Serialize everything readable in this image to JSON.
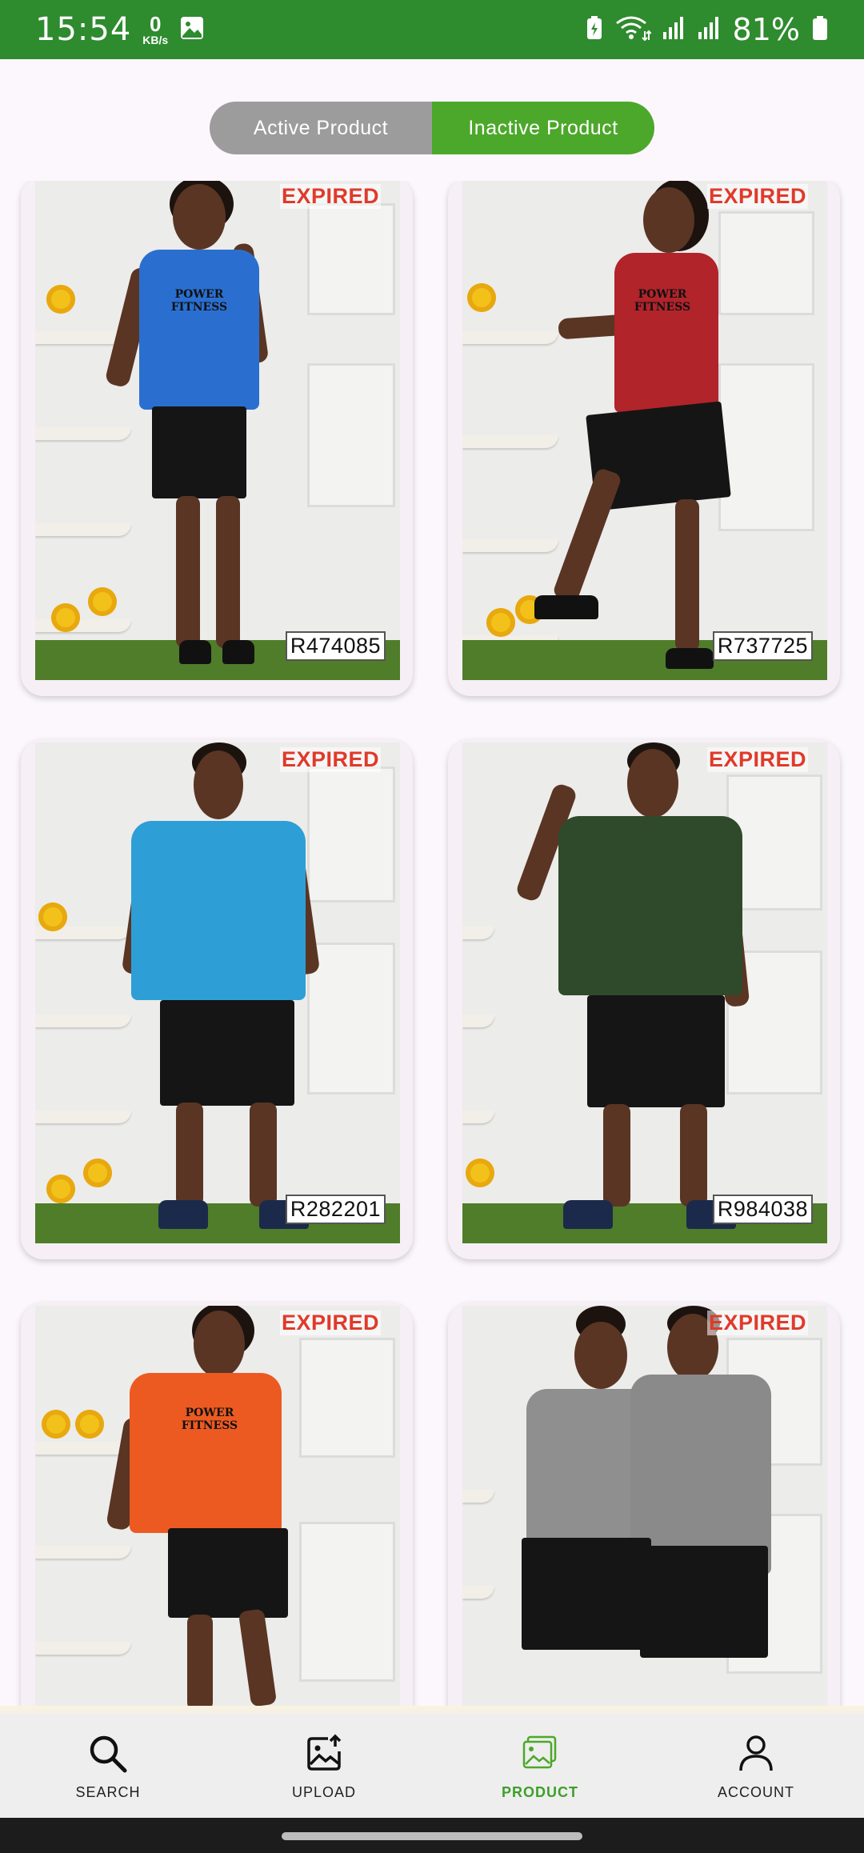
{
  "status_bar": {
    "time": "15:54",
    "net_speed_value": "0",
    "net_speed_unit": "KB/s",
    "battery_percent": "81%",
    "icons": [
      "image-icon",
      "battery-saver-icon",
      "wifi-icon",
      "signal-icon",
      "signal-icon",
      "battery-icon"
    ]
  },
  "segment": {
    "active_label": "Active Product",
    "inactive_label": "Inactive Product",
    "selected": "Inactive Product",
    "colors": {
      "unselected": "#9c9c9c",
      "selected": "#4ca82a"
    }
  },
  "products": [
    {
      "status": "EXPIRED",
      "code": "R474085",
      "shirt_color": "#2a6fd0",
      "shirt_text": "POWER FITNESS"
    },
    {
      "status": "EXPIRED",
      "code": "R737725",
      "shirt_color": "#b1242a",
      "shirt_text": "POWER FITNESS"
    },
    {
      "status": "EXPIRED",
      "code": "R282201",
      "shirt_color": "#2d9fd6",
      "shirt_text": ""
    },
    {
      "status": "EXPIRED",
      "code": "R984038",
      "shirt_color": "#2f4a2a",
      "shirt_text": ""
    },
    {
      "status": "EXPIRED",
      "code": "",
      "shirt_color": "#ec5a22",
      "shirt_text": "POWER FITNESS"
    },
    {
      "status": "EXPIRED",
      "code": "",
      "shirt_color": "#8a8a8a",
      "shirt_text": ""
    }
  ],
  "bottom_nav": {
    "items": [
      {
        "label": "SEARCH",
        "icon": "search-icon"
      },
      {
        "label": "UPLOAD",
        "icon": "upload-image-icon"
      },
      {
        "label": "PRODUCT",
        "icon": "product-gallery-icon"
      },
      {
        "label": "ACCOUNT",
        "icon": "account-icon"
      }
    ],
    "selected": "PRODUCT",
    "accent_color": "#3f9f2a"
  },
  "theme": {
    "status_bar_color": "#2e8b2e",
    "expired_color": "#e03a2a"
  }
}
